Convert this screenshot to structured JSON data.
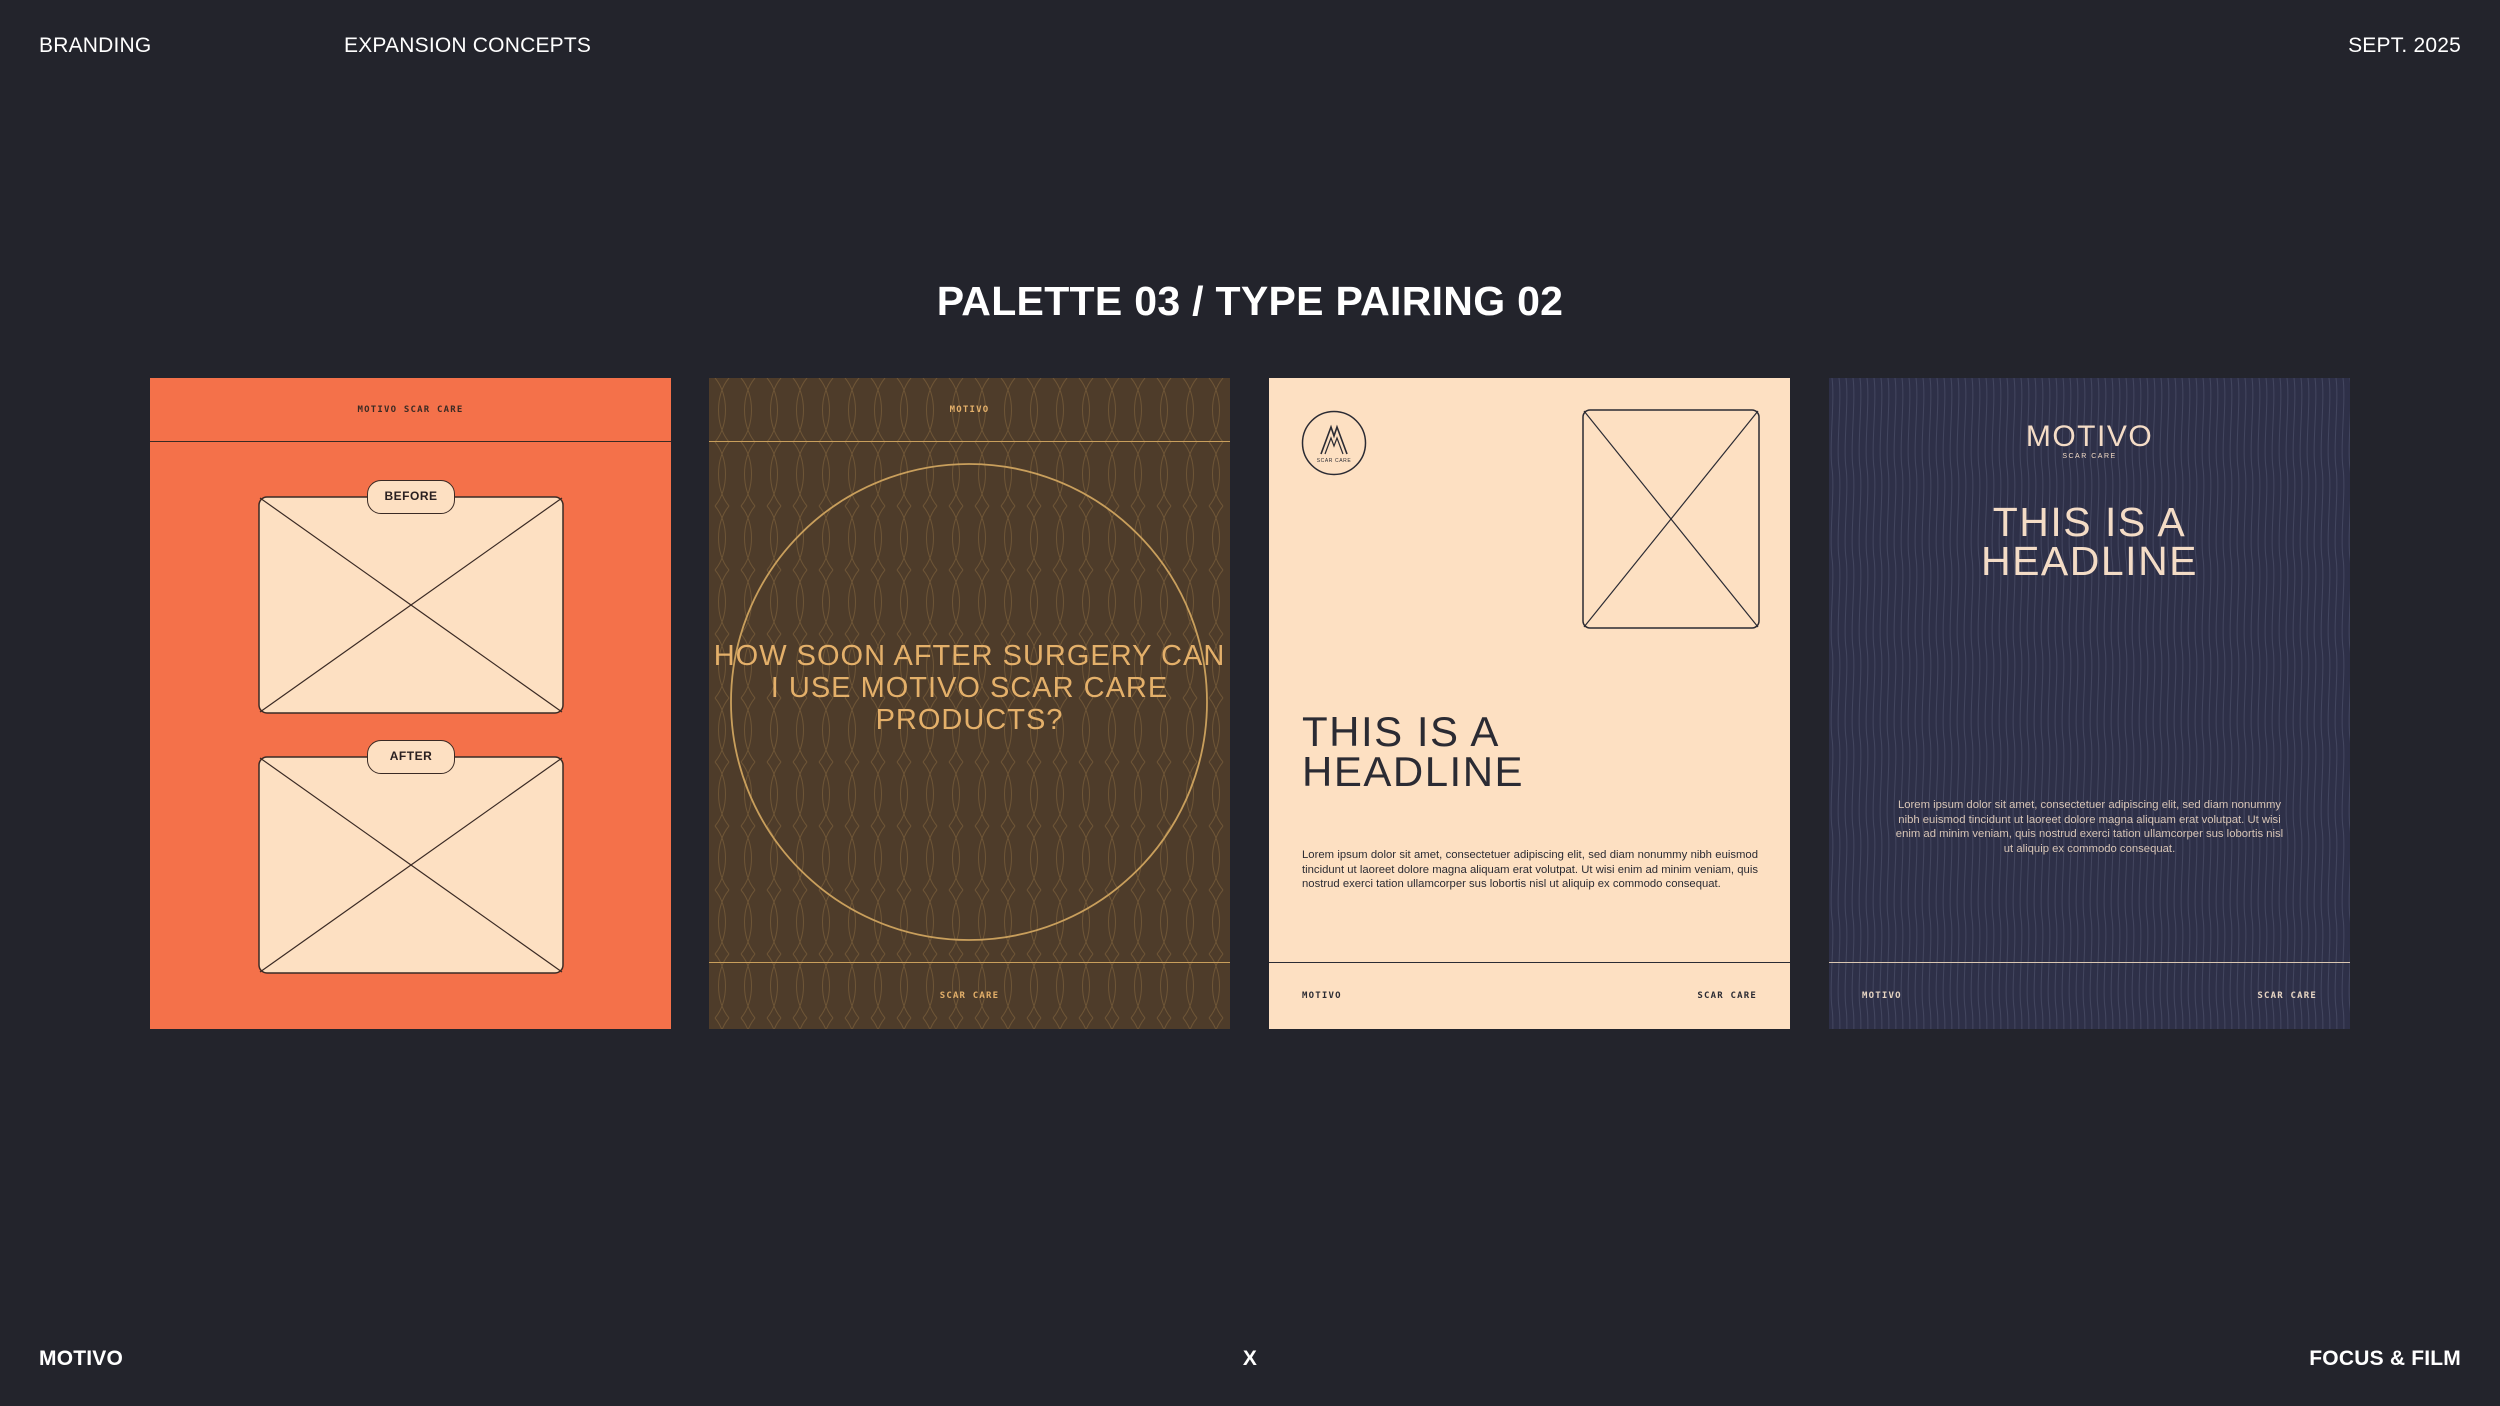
{
  "header": {
    "left": "BRANDING",
    "center": "EXPANSION CONCEPTS",
    "right": "SEPT. 2025"
  },
  "title": "PALETTE 03 / TYPE PAIRING 02",
  "footer": {
    "left": "MOTIVO",
    "center": "X",
    "right": "FOCUS & FILM"
  },
  "cards": [
    {
      "top_label": "MOTIVO SCAR CARE",
      "before_label": "BEFORE",
      "after_label": "AFTER",
      "bg": "#f4714a"
    },
    {
      "top_label": "MOTIVO",
      "question": "HOW SOON AFTER SURGERY CAN I USE MOTIVO SCAR CARE PRODUCTS?",
      "bottom_label": "SCAR CARE",
      "bg": "#4e3c2a"
    },
    {
      "logo_sub": "SCAR CARE",
      "headline": "THIS IS A HEADLINE",
      "body": "Lorem ipsum dolor sit amet, consectetuer adipiscing elit, sed diam nonummy nibh euismod tincidunt ut laoreet dolore magna aliquam erat volutpat. Ut wisi enim ad minim veniam, quis nostrud exerci tation ullamcorper sus lobortis nisl ut aliquip ex commodo consequat.",
      "footer_left": "MOTIVO",
      "footer_right": "SCAR CARE",
      "bg": "#fde0c2"
    },
    {
      "logo_word": "MOTIVO",
      "logo_sub": "SCAR CARE",
      "headline": "THIS IS A HEADLINE",
      "body": "Lorem ipsum dolor sit amet, consectetuer adipiscing elit, sed diam nonummy nibh euismod tincidunt ut laoreet dolore magna aliquam erat volutpat. Ut wisi enim ad minim veniam, quis nostrud exerci tation ullamcorper sus lobortis nisl ut aliquip ex commodo consequat.",
      "footer_left": "MOTIVO",
      "footer_right": "SCAR CARE",
      "bg": "#2e3048"
    }
  ]
}
